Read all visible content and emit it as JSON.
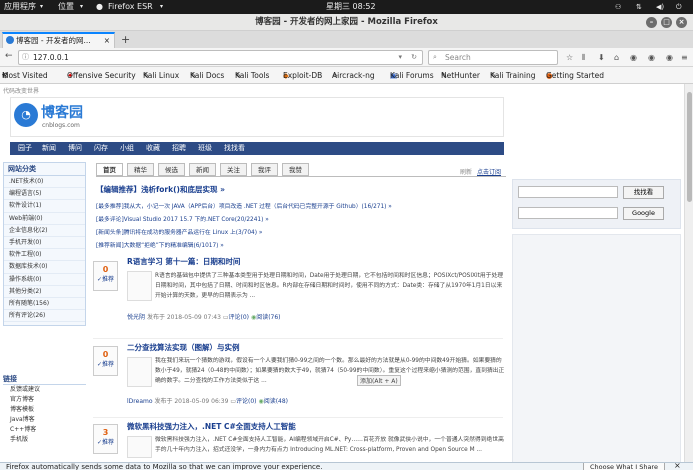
{
  "gnome": {
    "apps": "应用程序",
    "places": "位置",
    "app_name": "Firefox ESR",
    "clock": "星期三 08:52"
  },
  "window": {
    "title": "博客园 - 开发者的网上家园 - Mozilla Firefox"
  },
  "tab": {
    "title": "博客园 - 开发者的网...",
    "new_tab": "+"
  },
  "nav": {
    "url": "127.0.0.1",
    "search_placeholder": "Search"
  },
  "bookmarks": [
    "Most Visited",
    "Offensive Security",
    "Kali Linux",
    "Kali Docs",
    "Kali Tools",
    "Exploit-DB",
    "Aircrack-ng",
    "Kali Forums",
    "NetHunter",
    "Kali Training",
    "Getting Started"
  ],
  "site": {
    "top_link": "代码改变世界",
    "logo_text": "博客园",
    "logo_domain": "cnblogs.com",
    "nav": [
      "园子",
      "新闻",
      "博问",
      "闪存",
      "小组",
      "收藏",
      "招聘",
      "班级",
      "找找看"
    ],
    "cat_title": "网站分类",
    "categories": [
      ".NET技术(0)",
      "编程语言(5)",
      "软件设计(1)",
      "Web前端(0)",
      "企业信息化(2)",
      "手机开发(0)",
      "软件工程(0)",
      "数据库技术(0)",
      "操作系统(0)",
      "其他分类(2)",
      "所有随笔(156)",
      "所有评论(26)"
    ],
    "links_title": "链接",
    "links": [
      "反馈或建议",
      "官方博客",
      "博客模板",
      "Java博客",
      "C++博客",
      "手机版"
    ],
    "post_tabs": [
      "首页",
      "精华",
      "候选",
      "新闻",
      "关注",
      "我评",
      "我赞"
    ],
    "refresh": "刷新",
    "refresh_link": "点击订阅",
    "editor_pick": "【编辑推荐】浅析fork()和底层实现 »",
    "recommends": [
      "[最多推荐]我从大，小记一次 JAVA（APP后台）项目改造 .NET 过程（后台代码已完整开源于 Github）(16/271) »",
      "[最多评论]Visual Studio 2017 15.7 下的.NET Core(20/2241) »",
      "[新闻头条]腾讯将在成功的服务器产品运行在 Linux 上(3/704) »",
      "[推荐新闻]大数据“拒绝”下的精准编辑(6/1017) »"
    ],
    "posts": [
      {
        "count": "0",
        "digg": "推荐",
        "title": "R语言学习 第十一篇：日期和时间",
        "body": "R语言的基础包中提供了三种基本类型用于处理日期和时间，Date用于处理日期，它不包括时间和时区信息；POSIXct/POSIXlt用于处理日期和时间，其中包括了日期、时间和时区信息。R内部在存储日期和时间时，使用不同的方式：Date类：存储了从1970年1月1日以来开始计算的天数，更早的日期表示为 ...",
        "author": "悦光阴",
        "date": "发布于 2018-05-09 07:43",
        "comments": "评论(0)",
        "views": "阅读(76)"
      },
      {
        "count": "0",
        "digg": "推荐",
        "title": "二分查找算法实现（图解）与实例",
        "body": "我在我们来玩一个猜数的游戏，假设有一个人要我们猜0-99之间的一个数。那么最好的方法就是从0-99的中间数49开始猜。如果要猜的数小于49，就猜24（0-48的中间数）；如果要猜的数大于49，就猜74（50-99的中间数）。重复这个过程来缩小猜测的范围，直到猜出正确的数字。二分查找的工作方法类似于这 ...",
        "author": "lDreamo",
        "date": "发布于 2018-05-09 06:39",
        "comments": "评论(0)",
        "views": "阅读(48)"
      },
      {
        "count": "3",
        "digg": "推荐",
        "title": "微软黑科技强力注入，.NET C#全面支持人工智能",
        "body": "微软黑科技强力注入，.NET C#全面支持人工智能，AI编程领域开启C#、Py……百花齐放 就像武侠小说中，一个普通人突然得到绝世高手的几十年内力注入，招式还没学，一身内力有点力 Introducing ML.NET: Cross-platform, Proven and Open Source M ...",
        "author": "",
        "date": "",
        "comments": "",
        "views": ""
      }
    ],
    "tooltip": "添加(Alt + A)",
    "search_btn": "找找看",
    "google_btn": "Google"
  },
  "notification": {
    "text": "Firefox automatically sends some data to Mozilla so that we can improve your experience.",
    "button": "Choose What I Share"
  },
  "colors": {
    "accent": "#0a84ff",
    "site_nav": "#2d4b85",
    "link": "#1a3f8f"
  }
}
